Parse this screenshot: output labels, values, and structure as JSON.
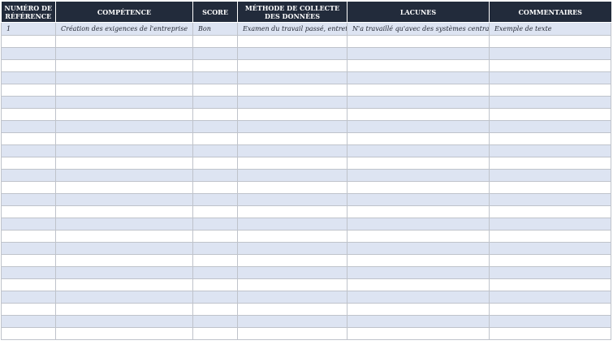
{
  "table": {
    "headers": {
      "reference": "NUMÉRO DE RÉFÉRENCE",
      "competence": "COMPÉTENCE",
      "score": "SCORE",
      "method": "MÉTHODE DE COLLECTE DES DONNÉES",
      "gaps": "LACUNES",
      "comments": "COMMENTAIRES"
    },
    "rows": [
      {
        "reference": "1",
        "competence": "Création des exigences de l'entreprise",
        "score": "Bon",
        "method": "Examen du travail passé, entretien",
        "gaps": "N'a travaillé qu'avec des systèmes centraux",
        "comments": "Exemple de texte"
      }
    ]
  },
  "colors": {
    "header_background": "#222b3b",
    "header_text": "#ffffff",
    "row_band": "#dde4f2",
    "row_plain": "#ffffff",
    "grid_line": "#bfc3cb"
  }
}
